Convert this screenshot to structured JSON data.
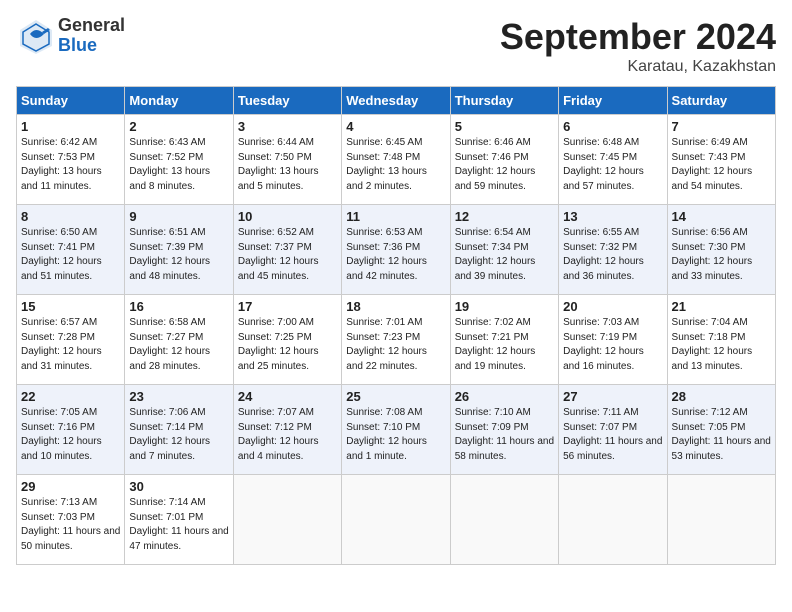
{
  "header": {
    "month": "September 2024",
    "location": "Karatau, Kazakhstan",
    "logo_general": "General",
    "logo_blue": "Blue"
  },
  "weekdays": [
    "Sunday",
    "Monday",
    "Tuesday",
    "Wednesday",
    "Thursday",
    "Friday",
    "Saturday"
  ],
  "weeks": [
    [
      {
        "day": "1",
        "sunrise": "Sunrise: 6:42 AM",
        "sunset": "Sunset: 7:53 PM",
        "daylight": "Daylight: 13 hours and 11 minutes."
      },
      {
        "day": "2",
        "sunrise": "Sunrise: 6:43 AM",
        "sunset": "Sunset: 7:52 PM",
        "daylight": "Daylight: 13 hours and 8 minutes."
      },
      {
        "day": "3",
        "sunrise": "Sunrise: 6:44 AM",
        "sunset": "Sunset: 7:50 PM",
        "daylight": "Daylight: 13 hours and 5 minutes."
      },
      {
        "day": "4",
        "sunrise": "Sunrise: 6:45 AM",
        "sunset": "Sunset: 7:48 PM",
        "daylight": "Daylight: 13 hours and 2 minutes."
      },
      {
        "day": "5",
        "sunrise": "Sunrise: 6:46 AM",
        "sunset": "Sunset: 7:46 PM",
        "daylight": "Daylight: 12 hours and 59 minutes."
      },
      {
        "day": "6",
        "sunrise": "Sunrise: 6:48 AM",
        "sunset": "Sunset: 7:45 PM",
        "daylight": "Daylight: 12 hours and 57 minutes."
      },
      {
        "day": "7",
        "sunrise": "Sunrise: 6:49 AM",
        "sunset": "Sunset: 7:43 PM",
        "daylight": "Daylight: 12 hours and 54 minutes."
      }
    ],
    [
      {
        "day": "8",
        "sunrise": "Sunrise: 6:50 AM",
        "sunset": "Sunset: 7:41 PM",
        "daylight": "Daylight: 12 hours and 51 minutes."
      },
      {
        "day": "9",
        "sunrise": "Sunrise: 6:51 AM",
        "sunset": "Sunset: 7:39 PM",
        "daylight": "Daylight: 12 hours and 48 minutes."
      },
      {
        "day": "10",
        "sunrise": "Sunrise: 6:52 AM",
        "sunset": "Sunset: 7:37 PM",
        "daylight": "Daylight: 12 hours and 45 minutes."
      },
      {
        "day": "11",
        "sunrise": "Sunrise: 6:53 AM",
        "sunset": "Sunset: 7:36 PM",
        "daylight": "Daylight: 12 hours and 42 minutes."
      },
      {
        "day": "12",
        "sunrise": "Sunrise: 6:54 AM",
        "sunset": "Sunset: 7:34 PM",
        "daylight": "Daylight: 12 hours and 39 minutes."
      },
      {
        "day": "13",
        "sunrise": "Sunrise: 6:55 AM",
        "sunset": "Sunset: 7:32 PM",
        "daylight": "Daylight: 12 hours and 36 minutes."
      },
      {
        "day": "14",
        "sunrise": "Sunrise: 6:56 AM",
        "sunset": "Sunset: 7:30 PM",
        "daylight": "Daylight: 12 hours and 33 minutes."
      }
    ],
    [
      {
        "day": "15",
        "sunrise": "Sunrise: 6:57 AM",
        "sunset": "Sunset: 7:28 PM",
        "daylight": "Daylight: 12 hours and 31 minutes."
      },
      {
        "day": "16",
        "sunrise": "Sunrise: 6:58 AM",
        "sunset": "Sunset: 7:27 PM",
        "daylight": "Daylight: 12 hours and 28 minutes."
      },
      {
        "day": "17",
        "sunrise": "Sunrise: 7:00 AM",
        "sunset": "Sunset: 7:25 PM",
        "daylight": "Daylight: 12 hours and 25 minutes."
      },
      {
        "day": "18",
        "sunrise": "Sunrise: 7:01 AM",
        "sunset": "Sunset: 7:23 PM",
        "daylight": "Daylight: 12 hours and 22 minutes."
      },
      {
        "day": "19",
        "sunrise": "Sunrise: 7:02 AM",
        "sunset": "Sunset: 7:21 PM",
        "daylight": "Daylight: 12 hours and 19 minutes."
      },
      {
        "day": "20",
        "sunrise": "Sunrise: 7:03 AM",
        "sunset": "Sunset: 7:19 PM",
        "daylight": "Daylight: 12 hours and 16 minutes."
      },
      {
        "day": "21",
        "sunrise": "Sunrise: 7:04 AM",
        "sunset": "Sunset: 7:18 PM",
        "daylight": "Daylight: 12 hours and 13 minutes."
      }
    ],
    [
      {
        "day": "22",
        "sunrise": "Sunrise: 7:05 AM",
        "sunset": "Sunset: 7:16 PM",
        "daylight": "Daylight: 12 hours and 10 minutes."
      },
      {
        "day": "23",
        "sunrise": "Sunrise: 7:06 AM",
        "sunset": "Sunset: 7:14 PM",
        "daylight": "Daylight: 12 hours and 7 minutes."
      },
      {
        "day": "24",
        "sunrise": "Sunrise: 7:07 AM",
        "sunset": "Sunset: 7:12 PM",
        "daylight": "Daylight: 12 hours and 4 minutes."
      },
      {
        "day": "25",
        "sunrise": "Sunrise: 7:08 AM",
        "sunset": "Sunset: 7:10 PM",
        "daylight": "Daylight: 12 hours and 1 minute."
      },
      {
        "day": "26",
        "sunrise": "Sunrise: 7:10 AM",
        "sunset": "Sunset: 7:09 PM",
        "daylight": "Daylight: 11 hours and 58 minutes."
      },
      {
        "day": "27",
        "sunrise": "Sunrise: 7:11 AM",
        "sunset": "Sunset: 7:07 PM",
        "daylight": "Daylight: 11 hours and 56 minutes."
      },
      {
        "day": "28",
        "sunrise": "Sunrise: 7:12 AM",
        "sunset": "Sunset: 7:05 PM",
        "daylight": "Daylight: 11 hours and 53 minutes."
      }
    ],
    [
      {
        "day": "29",
        "sunrise": "Sunrise: 7:13 AM",
        "sunset": "Sunset: 7:03 PM",
        "daylight": "Daylight: 11 hours and 50 minutes."
      },
      {
        "day": "30",
        "sunrise": "Sunrise: 7:14 AM",
        "sunset": "Sunset: 7:01 PM",
        "daylight": "Daylight: 11 hours and 47 minutes."
      },
      {
        "day": "",
        "sunrise": "",
        "sunset": "",
        "daylight": ""
      },
      {
        "day": "",
        "sunrise": "",
        "sunset": "",
        "daylight": ""
      },
      {
        "day": "",
        "sunrise": "",
        "sunset": "",
        "daylight": ""
      },
      {
        "day": "",
        "sunrise": "",
        "sunset": "",
        "daylight": ""
      },
      {
        "day": "",
        "sunrise": "",
        "sunset": "",
        "daylight": ""
      }
    ]
  ]
}
